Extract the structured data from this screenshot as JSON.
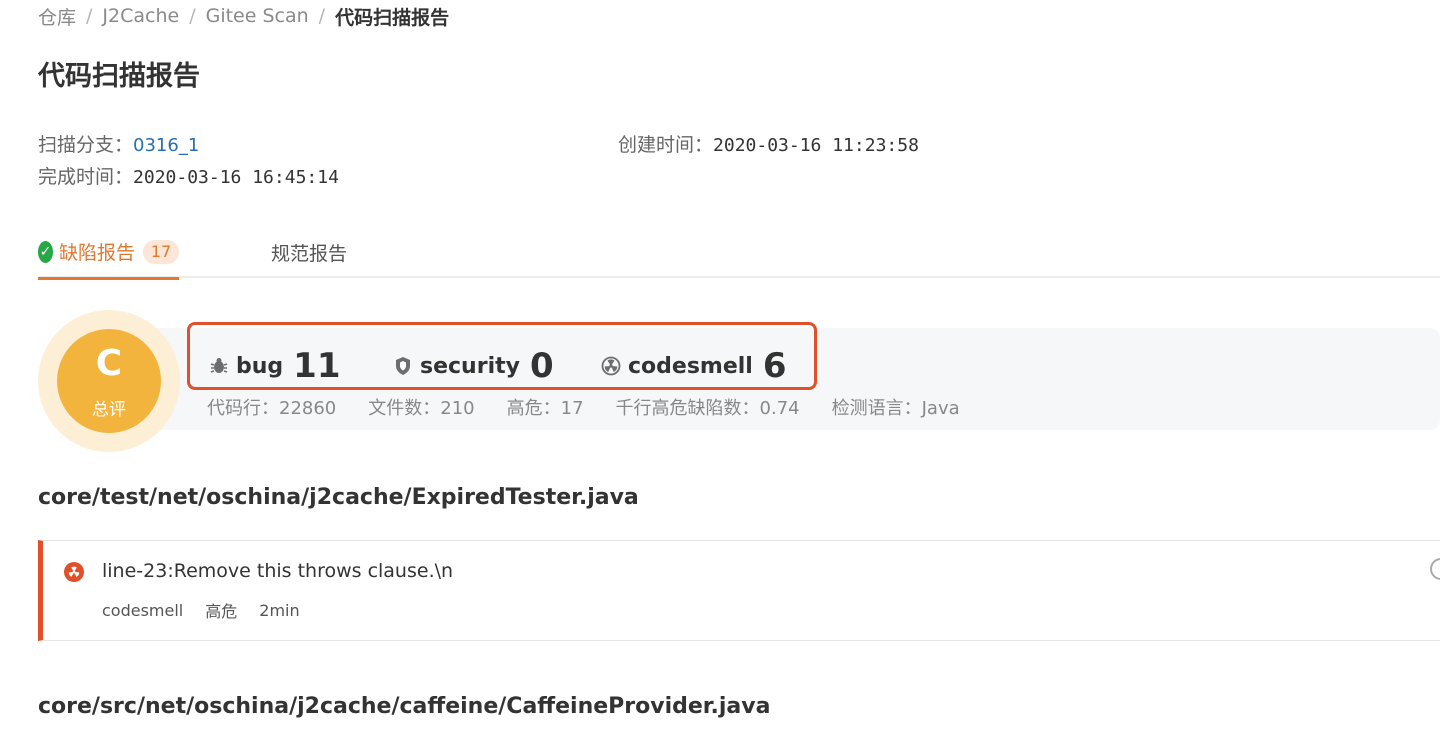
{
  "breadcrumb": {
    "items": [
      "仓库",
      "J2Cache",
      "Gitee Scan"
    ],
    "separator": "/",
    "current": "代码扫描报告"
  },
  "page": {
    "title": "代码扫描报告"
  },
  "meta": {
    "branch_label": "扫描分支：",
    "branch_value": "0316_1",
    "created_label": "创建时间：",
    "created_value": "2020-03-16 11:23:58",
    "finished_label": "完成时间：",
    "finished_value": "2020-03-16 16:45:14"
  },
  "tabs": [
    {
      "label": "缺陷报告",
      "count": "17",
      "active": true,
      "icon": "check-circle-icon"
    },
    {
      "label": "规范报告",
      "active": false
    }
  ],
  "summary": {
    "grade": "C",
    "grade_label": "总评",
    "metrics": [
      {
        "icon": "bug-icon",
        "name": "bug",
        "value": "11"
      },
      {
        "icon": "shield-icon",
        "name": "security",
        "value": "0"
      },
      {
        "icon": "radiation-icon",
        "name": "codesmell",
        "value": "6"
      }
    ],
    "stats": [
      "代码行：22860",
      "文件数：210",
      "高危：17",
      "千行高危缺陷数：0.74",
      "检测语言：Java"
    ]
  },
  "files": [
    {
      "path": "core/test/net/oschina/j2cache/ExpiredTester.java",
      "issues": [
        {
          "title": "line-23:Remove this throws clause.\\n",
          "type": "codesmell",
          "severity": "高危",
          "effort": "2min"
        }
      ]
    },
    {
      "path": "core/src/net/oschina/j2cache/caffeine/CaffeineProvider.java"
    }
  ],
  "colors": {
    "accent": "#e0782f",
    "danger": "#e0502b",
    "grade": "#f3b43e",
    "success": "#27a745"
  }
}
